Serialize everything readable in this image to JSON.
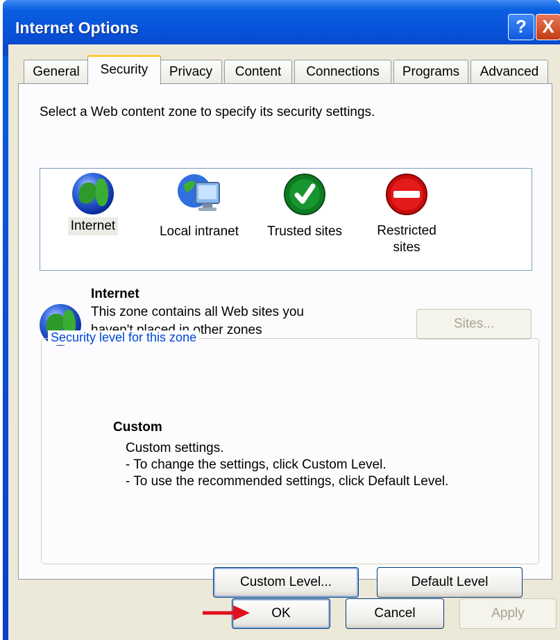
{
  "window": {
    "title": "Internet Options",
    "help_glyph": "?",
    "close_glyph": "X"
  },
  "tabs": [
    {
      "label": "General",
      "active": false
    },
    {
      "label": "Security",
      "active": true
    },
    {
      "label": "Privacy",
      "active": false
    },
    {
      "label": "Content",
      "active": false
    },
    {
      "label": "Connections",
      "active": false
    },
    {
      "label": "Programs",
      "active": false
    },
    {
      "label": "Advanced",
      "active": false
    }
  ],
  "security": {
    "instruction": "Select a Web content zone to specify its security settings.",
    "zones": [
      {
        "label": "Internet",
        "icon": "globe-icon",
        "selected": true
      },
      {
        "label": "Local intranet",
        "icon": "intranet-icon",
        "selected": false
      },
      {
        "label": "Trusted sites",
        "icon": "checkmark-icon",
        "selected": false
      },
      {
        "label_line1": "Restricted",
        "label_line2": "sites",
        "icon": "no-entry-icon",
        "selected": false
      }
    ],
    "selected_zone": {
      "name": "Internet",
      "desc_line1": "This zone contains all Web sites you",
      "desc_line2": "haven't placed in other zones",
      "sites_button": "Sites..."
    },
    "level_group": {
      "caption": "Security level for this zone",
      "level_name": "Custom",
      "line1": "Custom settings.",
      "line2": "- To change the settings, click Custom Level.",
      "line3": "- To use the recommended settings, click Default Level.",
      "custom_level_button": "Custom Level...",
      "default_level_button": "Default Level"
    }
  },
  "footer": {
    "ok": "OK",
    "cancel": "Cancel",
    "apply": "Apply"
  },
  "colors": {
    "titlebar": "#0a5fe0",
    "caption_blue": "#0046d5",
    "arrow_red": "#e01020",
    "active_tab_accent": "#ffc83c"
  }
}
